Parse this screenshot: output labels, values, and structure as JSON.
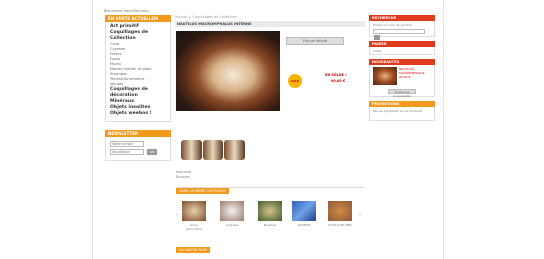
{
  "header": {
    "topbar_text": "Bienvenue identifiez-vous"
  },
  "left": {
    "categories_title": "EN VENTE ACTUELLEM",
    "categories": [
      {
        "label": "Art primitif",
        "big": true
      },
      {
        "label": "Coquillages de Collection",
        "big": true
      },
      {
        "label": "Cone",
        "big": false
      },
      {
        "label": "Cypraea",
        "big": false
      },
      {
        "label": "Divers",
        "big": false
      },
      {
        "label": "Fusus",
        "big": false
      },
      {
        "label": "Murex",
        "big": false
      },
      {
        "label": "Nacres mother of pearl",
        "big": false
      },
      {
        "label": "Strombes",
        "big": false
      },
      {
        "label": "Terrestrial terrestre",
        "big": false
      },
      {
        "label": "Volutes",
        "big": false
      },
      {
        "label": "Coquillages de décoration",
        "big": true
      },
      {
        "label": "Minéraux",
        "big": true
      },
      {
        "label": "Objets insolites",
        "big": true
      },
      {
        "label": "Objets weebos !",
        "big": true
      }
    ],
    "newsletter_title": "NEWSLETTER",
    "newsletter_input": "Votre e-mail",
    "newsletter_select": "Inscription",
    "newsletter_ok": "ok"
  },
  "center": {
    "breadcrumb": "Accueil > Coquillages de Collection",
    "product_title": "NAUTILUS MACROMPHALUS INTERNE",
    "add_button": "Plus de détails",
    "sale_badge": "SALE",
    "price_label": "EN SOLDE !",
    "price_value": "90,00 €",
    "links": [
      "Imprimer",
      "Envoyer"
    ],
    "same_category_title": "DANS LA MÊME CATÉGORIE",
    "related": [
      {
        "label": "Cône Auriculaire"
      },
      {
        "label": "Cypraea"
      },
      {
        "label": "Nautilus"
      },
      {
        "label": "AZURITE"
      },
      {
        "label": "ETOILE DE MER"
      }
    ],
    "bottom_tag": "EN SAVOIR PLUS"
  },
  "right": {
    "search_title": "RECHERCHE",
    "search_text": "Entrez un nom de produit",
    "cart_title": "PANIER",
    "cart_text": "(vide)",
    "news_title": "NOUVEAUTÉS",
    "news_text": "NAUTILUS MACROMPHALUS",
    "news_price": "90,00 €",
    "news_button": "Toutes les nouveautés",
    "promo_title": "PROMOTIONS",
    "promo_text": "Pas de promotion en ce moment"
  },
  "colors": {
    "orange": "#f29a1e",
    "red": "#e03a1c"
  }
}
